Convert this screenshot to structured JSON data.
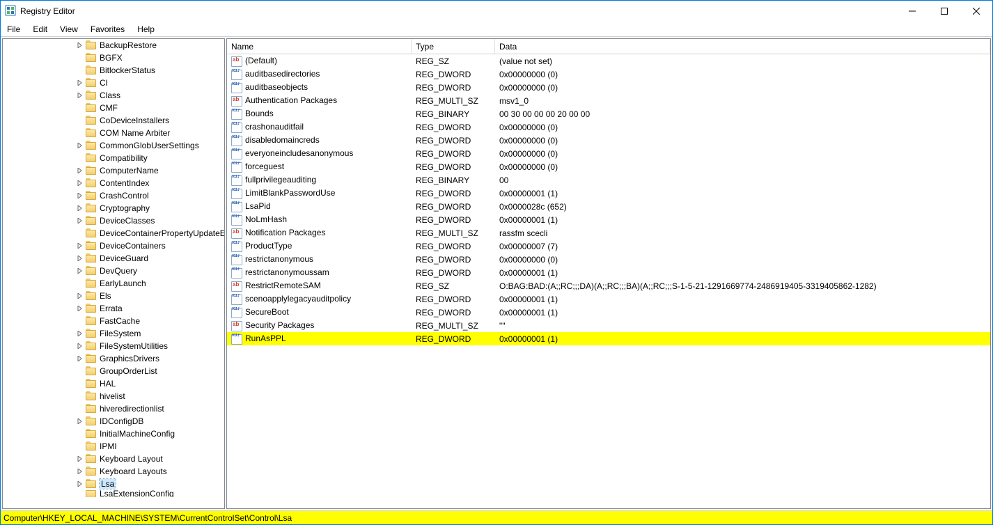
{
  "title": "Registry Editor",
  "menus": [
    "File",
    "Edit",
    "View",
    "Favorites",
    "Help"
  ],
  "statusbar_path": "Computer\\HKEY_LOCAL_MACHINE\\SYSTEM\\CurrentControlSet\\Control\\Lsa",
  "columns": {
    "name": "Name",
    "type": "Type",
    "data": "Data"
  },
  "tree": [
    {
      "label": "BackupRestore",
      "expandable": true
    },
    {
      "label": "BGFX",
      "expandable": false
    },
    {
      "label": "BitlockerStatus",
      "expandable": false
    },
    {
      "label": "CI",
      "expandable": true
    },
    {
      "label": "Class",
      "expandable": true
    },
    {
      "label": "CMF",
      "expandable": false
    },
    {
      "label": "CoDeviceInstallers",
      "expandable": false
    },
    {
      "label": "COM Name Arbiter",
      "expandable": false
    },
    {
      "label": "CommonGlobUserSettings",
      "expandable": true
    },
    {
      "label": "Compatibility",
      "expandable": false
    },
    {
      "label": "ComputerName",
      "expandable": true
    },
    {
      "label": "ContentIndex",
      "expandable": true
    },
    {
      "label": "CrashControl",
      "expandable": true
    },
    {
      "label": "Cryptography",
      "expandable": true
    },
    {
      "label": "DeviceClasses",
      "expandable": true
    },
    {
      "label": "DeviceContainerPropertyUpdateEvents",
      "expandable": false
    },
    {
      "label": "DeviceContainers",
      "expandable": true
    },
    {
      "label": "DeviceGuard",
      "expandable": true
    },
    {
      "label": "DevQuery",
      "expandable": true
    },
    {
      "label": "EarlyLaunch",
      "expandable": false
    },
    {
      "label": "Els",
      "expandable": true
    },
    {
      "label": "Errata",
      "expandable": true
    },
    {
      "label": "FastCache",
      "expandable": false
    },
    {
      "label": "FileSystem",
      "expandable": true
    },
    {
      "label": "FileSystemUtilities",
      "expandable": true
    },
    {
      "label": "GraphicsDrivers",
      "expandable": true
    },
    {
      "label": "GroupOrderList",
      "expandable": false
    },
    {
      "label": "HAL",
      "expandable": false
    },
    {
      "label": "hivelist",
      "expandable": false
    },
    {
      "label": "hiveredirectionlist",
      "expandable": false
    },
    {
      "label": "IDConfigDB",
      "expandable": true
    },
    {
      "label": "InitialMachineConfig",
      "expandable": false
    },
    {
      "label": "IPMI",
      "expandable": false
    },
    {
      "label": "Keyboard Layout",
      "expandable": true
    },
    {
      "label": "Keyboard Layouts",
      "expandable": true
    },
    {
      "label": "Lsa",
      "expandable": true,
      "selected": true
    }
  ],
  "values": [
    {
      "name": "(Default)",
      "type": "REG_SZ",
      "data": "(value not set)",
      "icon": "sz"
    },
    {
      "name": "auditbasedirectories",
      "type": "REG_DWORD",
      "data": "0x00000000 (0)",
      "icon": "bin"
    },
    {
      "name": "auditbaseobjects",
      "type": "REG_DWORD",
      "data": "0x00000000 (0)",
      "icon": "bin"
    },
    {
      "name": "Authentication Packages",
      "type": "REG_MULTI_SZ",
      "data": "msv1_0",
      "icon": "sz"
    },
    {
      "name": "Bounds",
      "type": "REG_BINARY",
      "data": "00 30 00 00 00 20 00 00",
      "icon": "bin"
    },
    {
      "name": "crashonauditfail",
      "type": "REG_DWORD",
      "data": "0x00000000 (0)",
      "icon": "bin"
    },
    {
      "name": "disabledomaincreds",
      "type": "REG_DWORD",
      "data": "0x00000000 (0)",
      "icon": "bin"
    },
    {
      "name": "everyoneincludesanonymous",
      "type": "REG_DWORD",
      "data": "0x00000000 (0)",
      "icon": "bin"
    },
    {
      "name": "forceguest",
      "type": "REG_DWORD",
      "data": "0x00000000 (0)",
      "icon": "bin"
    },
    {
      "name": "fullprivilegeauditing",
      "type": "REG_BINARY",
      "data": "00",
      "icon": "bin"
    },
    {
      "name": "LimitBlankPasswordUse",
      "type": "REG_DWORD",
      "data": "0x00000001 (1)",
      "icon": "bin"
    },
    {
      "name": "LsaPid",
      "type": "REG_DWORD",
      "data": "0x0000028c (652)",
      "icon": "bin"
    },
    {
      "name": "NoLmHash",
      "type": "REG_DWORD",
      "data": "0x00000001 (1)",
      "icon": "bin"
    },
    {
      "name": "Notification Packages",
      "type": "REG_MULTI_SZ",
      "data": "rassfm scecli",
      "icon": "sz"
    },
    {
      "name": "ProductType",
      "type": "REG_DWORD",
      "data": "0x00000007 (7)",
      "icon": "bin"
    },
    {
      "name": "restrictanonymous",
      "type": "REG_DWORD",
      "data": "0x00000000 (0)",
      "icon": "bin"
    },
    {
      "name": "restrictanonymoussam",
      "type": "REG_DWORD",
      "data": "0x00000001 (1)",
      "icon": "bin"
    },
    {
      "name": "RestrictRemoteSAM",
      "type": "REG_SZ",
      "data": "O:BAG:BAD:(A;;RC;;;DA)(A;;RC;;;BA)(A;;RC;;;S-1-5-21-1291669774-2486919405-3319405862-1282)",
      "icon": "sz"
    },
    {
      "name": "scenoapplylegacyauditpolicy",
      "type": "REG_DWORD",
      "data": "0x00000001 (1)",
      "icon": "bin"
    },
    {
      "name": "SecureBoot",
      "type": "REG_DWORD",
      "data": "0x00000001 (1)",
      "icon": "bin"
    },
    {
      "name": "Security Packages",
      "type": "REG_MULTI_SZ",
      "data": "\"\"",
      "icon": "sz"
    },
    {
      "name": "RunAsPPL",
      "type": "REG_DWORD",
      "data": "0x00000001 (1)",
      "icon": "bin",
      "highlighted": true
    }
  ]
}
